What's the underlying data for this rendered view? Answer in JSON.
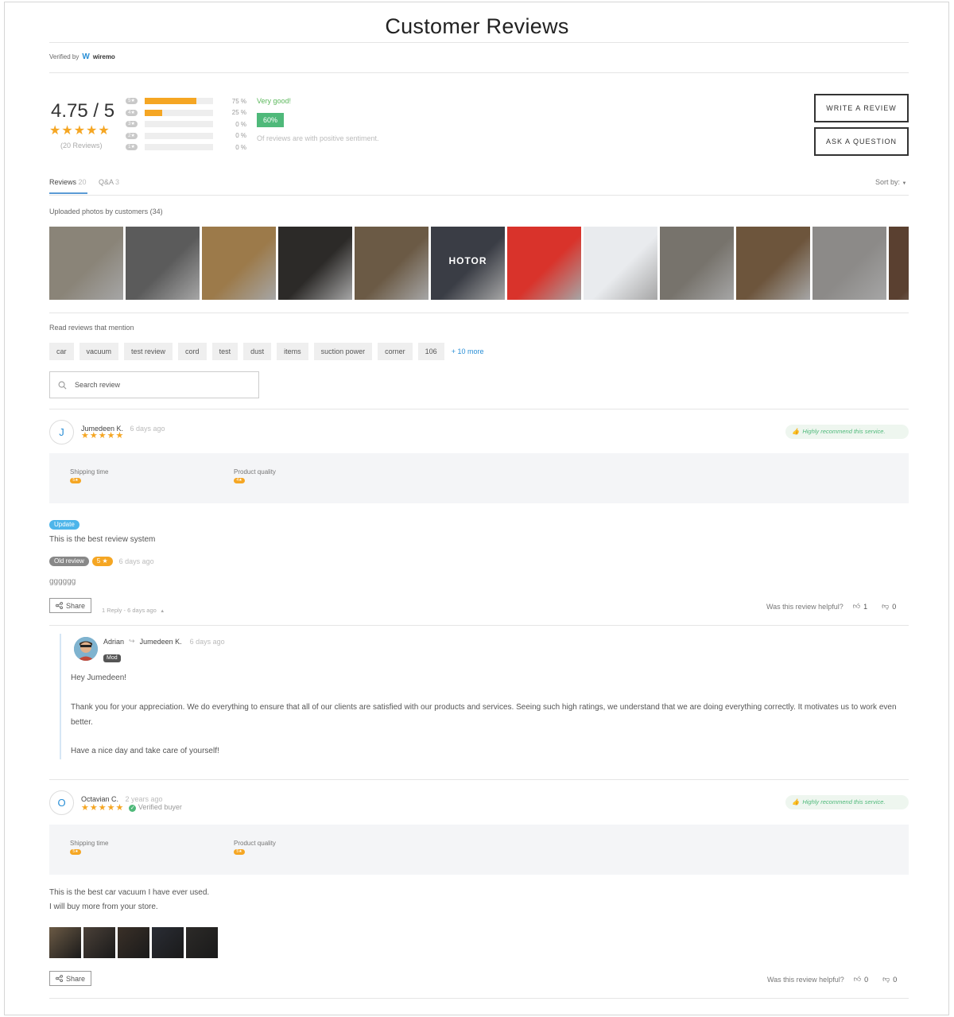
{
  "header": {
    "title": "Customer Reviews",
    "verified_by": "Verified by",
    "brand": "wiremo"
  },
  "summary": {
    "score": "4.75 / 5",
    "stars": "★★★★★",
    "review_count": "(20 Reviews)",
    "distribution": [
      {
        "label": "5★",
        "percent": 75,
        "text": "75 %"
      },
      {
        "label": "4★",
        "percent": 25,
        "text": "25 %"
      },
      {
        "label": "3★",
        "percent": 0,
        "text": "0 %"
      },
      {
        "label": "2★",
        "percent": 0,
        "text": "0 %"
      },
      {
        "label": "1★",
        "percent": 0,
        "text": "0 %"
      }
    ],
    "sentiment_label": "Very good!",
    "sentiment_value": "60%",
    "sentiment_desc": "Of reviews are with positive sentiment."
  },
  "actions": {
    "write_review": "WRITE A REVIEW",
    "ask_question": "ASK A QUESTION"
  },
  "tabs": {
    "reviews_label": "Reviews",
    "reviews_count": "20",
    "qa_label": "Q&A",
    "qa_count": "3",
    "sort_label": "Sort by:"
  },
  "photos": {
    "label": "Uploaded photos by customers (34)",
    "colors": [
      "#8a8478",
      "#5b5b5b",
      "#9c7a4a",
      "#2c2a28",
      "#6b5a45",
      "#3a3d45",
      "#d9332b",
      "#e9ebee",
      "#77736c",
      "#6d553c",
      "#8c8a88",
      "#5a4030"
    ],
    "overlay_text_6": "HOTOR"
  },
  "mentions": {
    "label": "Read reviews that mention",
    "chips": [
      "car",
      "vacuum",
      "test review",
      "cord",
      "test",
      "dust",
      "items",
      "suction power",
      "corner",
      "106"
    ],
    "more": "+ 10 more"
  },
  "search": {
    "placeholder": "Search review"
  },
  "review1": {
    "initial": "J",
    "name": "Jumedeen K.",
    "time": "6 days ago",
    "stars": "★★★★★",
    "recommend": "Highly recommend this service.",
    "shipping_label": "Shipping time",
    "shipping_value": "5★",
    "quality_label": "Product quality",
    "quality_value": "4★",
    "update_pill": "Update",
    "text": "This is the best review system",
    "old_pill": "Old review",
    "old_rating": "5 ★",
    "old_time": "6 days ago",
    "old_text": "gggggg",
    "share": "Share",
    "reply_meta": "1 Reply - 6 days ago",
    "helpful": "Was this review helpful?",
    "up": "1",
    "down": "0"
  },
  "reply": {
    "name": "Adrian",
    "to": "Jumedeen K.",
    "time": "6 days ago",
    "badge": "Mod",
    "p1": "Hey Jumedeen!",
    "p2": "Thank you for your appreciation. We do everything to ensure that all of our clients are satisfied with our products and services. Seeing such high ratings, we understand that we are doing everything correctly. It motivates us to work even better.",
    "p3": "Have a nice day and take care of yourself!"
  },
  "review2": {
    "initial": "O",
    "name": "Octavian C.",
    "time": "2 years ago",
    "stars": "★★★★★",
    "verified": "Verified buyer",
    "recommend": "Highly recommend this service.",
    "shipping_label": "Shipping time",
    "shipping_value": "5★",
    "quality_label": "Product quality",
    "quality_value": "5★",
    "line1": "This is the best car vacuum I have ever used.",
    "line2": "I will buy more from your store.",
    "thumb_colors": [
      "#6b5a45",
      "#4a4038",
      "#3a3028",
      "#2a2d35",
      "#2c2a28"
    ],
    "share": "Share",
    "helpful": "Was this review helpful?",
    "up": "0",
    "down": "0"
  }
}
